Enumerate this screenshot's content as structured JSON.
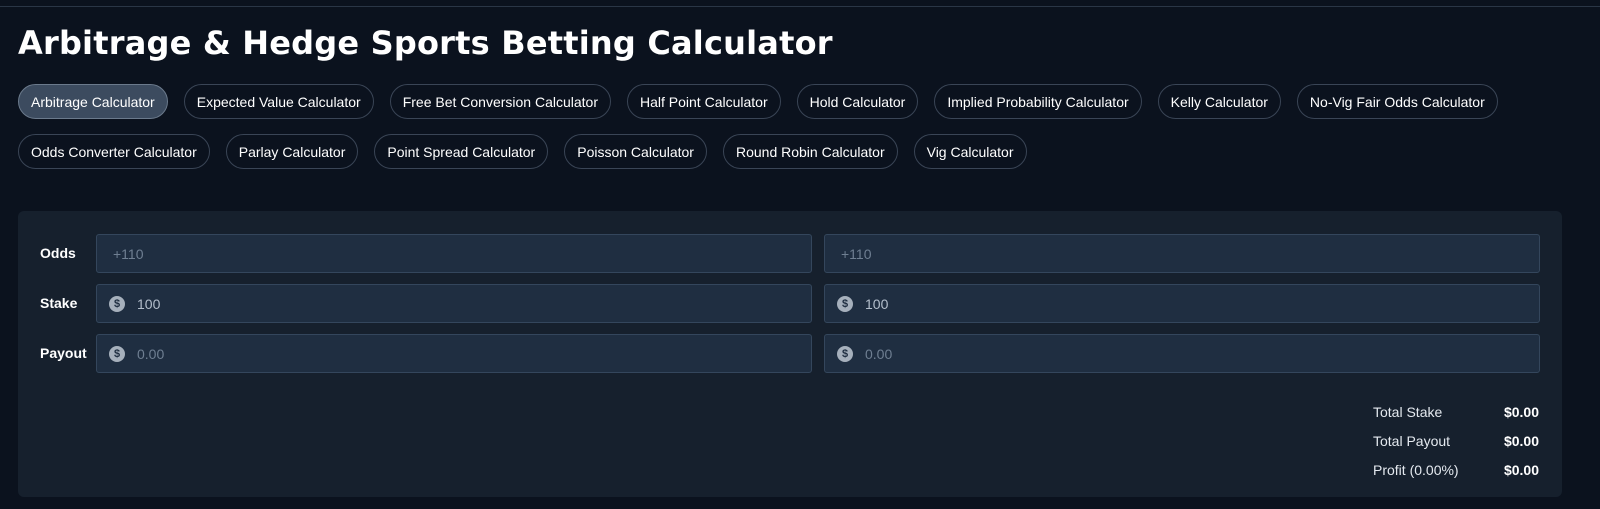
{
  "page": {
    "title": "Arbitrage & Hedge Sports Betting Calculator"
  },
  "nav": {
    "chips": [
      {
        "label": "Arbitrage Calculator",
        "active": true
      },
      {
        "label": "Expected Value Calculator",
        "active": false
      },
      {
        "label": "Free Bet Conversion Calculator",
        "active": false
      },
      {
        "label": "Half Point Calculator",
        "active": false
      },
      {
        "label": "Hold Calculator",
        "active": false
      },
      {
        "label": "Implied Probability Calculator",
        "active": false
      },
      {
        "label": "Kelly Calculator",
        "active": false
      },
      {
        "label": "No-Vig Fair Odds Calculator",
        "active": false
      },
      {
        "label": "Odds Converter Calculator",
        "active": false
      },
      {
        "label": "Parlay Calculator",
        "active": false
      },
      {
        "label": "Point Spread Calculator",
        "active": false
      },
      {
        "label": "Poisson Calculator",
        "active": false
      },
      {
        "label": "Round Robin Calculator",
        "active": false
      },
      {
        "label": "Vig Calculator",
        "active": false
      }
    ]
  },
  "calculator": {
    "rows": {
      "odds": {
        "label": "Odds",
        "bet1_placeholder": "+110",
        "bet2_placeholder": "+110"
      },
      "stake": {
        "label": "Stake",
        "icon": "dollar-icon",
        "bet1_value": "100",
        "bet2_value": "100"
      },
      "payout": {
        "label": "Payout",
        "icon": "dollar-icon",
        "bet1_placeholder": "0.00",
        "bet2_placeholder": "0.00"
      }
    },
    "currency_symbol": "$",
    "summary": {
      "total_stake": {
        "label": "Total Stake",
        "value": "$0.00"
      },
      "total_payout": {
        "label": "Total Payout",
        "value": "$0.00"
      },
      "profit": {
        "label": "Profit (0.00%)",
        "value": "$0.00"
      }
    }
  }
}
